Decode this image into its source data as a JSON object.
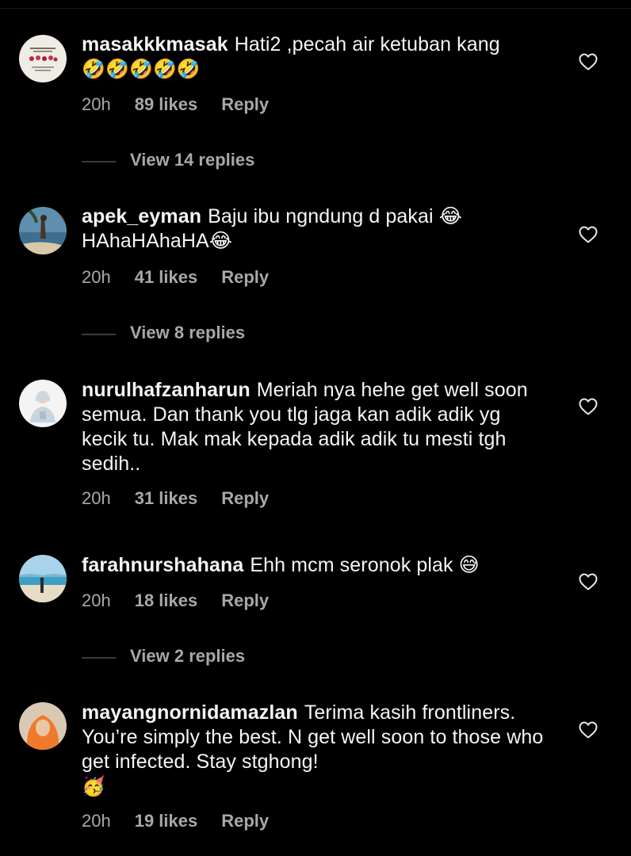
{
  "comments": [
    {
      "username": "masakkkmasak",
      "text": "Hati2 ,pecah air ketuban kang",
      "emoji_line": "🤣🤣🤣🤣🤣",
      "time": "20h",
      "likes": "89 likes",
      "reply": "Reply",
      "view_replies": "View 14 replies"
    },
    {
      "username": "apek_eyman",
      "text": "Baju ibu ngndung d pakai 😂 HAhaHAhaHA😂",
      "time": "20h",
      "likes": "41 likes",
      "reply": "Reply",
      "view_replies": "View 8 replies"
    },
    {
      "username": "nurulhafzanharun",
      "text": "Meriah nya hehe get well soon semua. Dan thank you tlg jaga kan adik adik yg kecik tu. Mak mak kepada adik adik tu mesti tgh sedih..",
      "time": "20h",
      "likes": "31 likes",
      "reply": "Reply"
    },
    {
      "username": "farahnurshahana",
      "text": "Ehh mcm seronok plak 😅",
      "time": "20h",
      "likes": "18 likes",
      "reply": "Reply",
      "view_replies": "View 2 replies"
    },
    {
      "username": "mayangnornidamazlan",
      "text": "Terima kasih frontliners. You’re simply the best. N get well soon to those who get infected. Stay stghong!",
      "emoji_line": "🥳",
      "time": "20h",
      "likes": "19 likes",
      "reply": "Reply"
    }
  ],
  "icons": {
    "like": "heart-outline-icon"
  },
  "colors": {
    "background": "#000000",
    "primary_text": "#f5f5f5",
    "secondary_text": "#a8a8a8"
  }
}
